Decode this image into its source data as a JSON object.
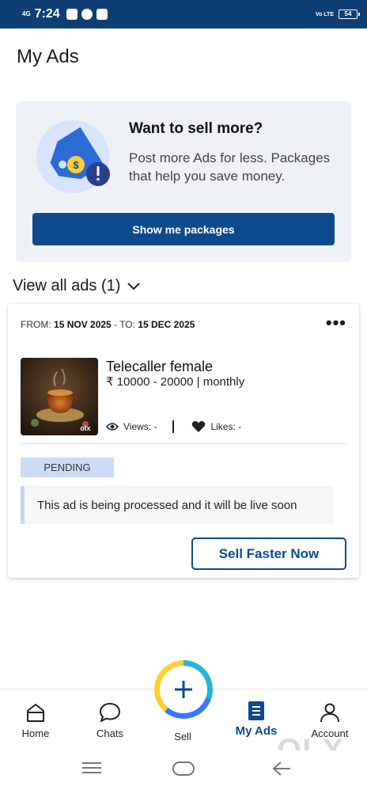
{
  "status_bar": {
    "network": "4G",
    "time": "7:24",
    "volte": "Vo LTE",
    "battery": "54"
  },
  "page": {
    "title": "My Ads"
  },
  "promo": {
    "heading": "Want to sell more?",
    "text": "Post more Ads for less. Packages that help you save money.",
    "button_label": "Show me packages"
  },
  "view_all": {
    "label": "View all ads (1)"
  },
  "ad": {
    "from_label": "FROM:",
    "from_date": "15 NOV 2025",
    "to_label": "- TO:",
    "to_date": "15 DEC 2025",
    "title": "Telecaller female",
    "price": "₹ 10000 - 20000 | monthly",
    "views_label": "Views: -",
    "likes_label": "Likes: -",
    "thumb_watermark": "olx",
    "status": "PENDING",
    "note": "This ad is being processed and it will be live soon",
    "cta_label": "Sell Faster Now"
  },
  "bottom_nav": {
    "items": [
      {
        "label": "Home",
        "icon": "home-icon"
      },
      {
        "label": "Chats",
        "icon": "chat-icon"
      },
      {
        "label": "Sell",
        "icon": "plus-icon"
      },
      {
        "label": "My Ads",
        "icon": "ads-icon",
        "active": true
      },
      {
        "label": "Account",
        "icon": "account-icon"
      }
    ]
  },
  "watermark": "OLX",
  "colors": {
    "brand": "#0d4a8c",
    "status_bar": "#0e3f73",
    "promo_bg": "#eef1f5",
    "badge_bg": "#ccdcf7"
  }
}
